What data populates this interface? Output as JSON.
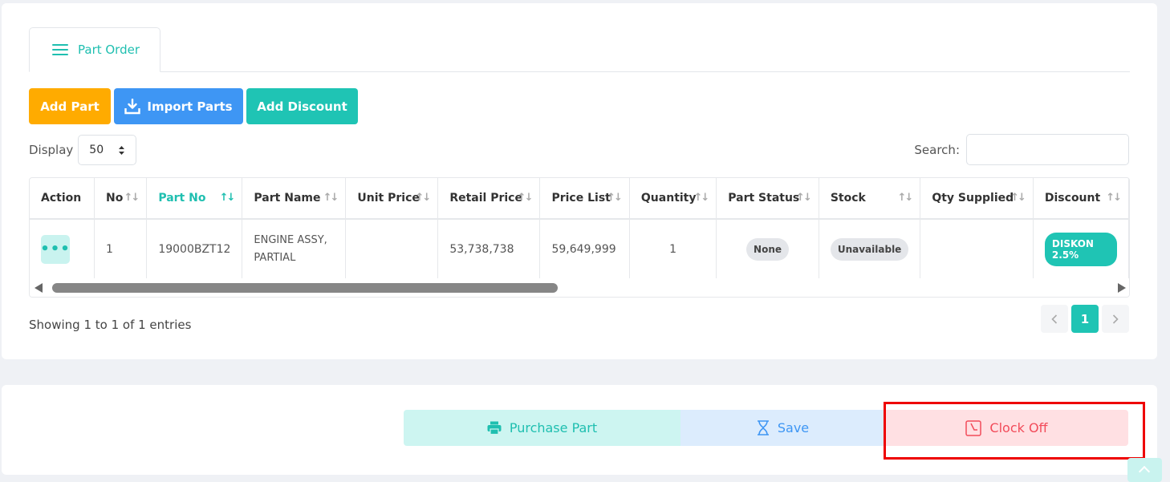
{
  "tabs": [
    {
      "label": "Part Order",
      "icon": "menu-icon"
    }
  ],
  "toolbar": {
    "add_part": "Add Part",
    "import_parts": "Import Parts",
    "add_discount": "Add Discount"
  },
  "display": {
    "label": "Display",
    "value": "50"
  },
  "search": {
    "label": "Search:",
    "value": "",
    "placeholder": ""
  },
  "table": {
    "columns": [
      "Action",
      "No",
      "Part No",
      "Part Name",
      "Unit Price",
      "Retail Price",
      "Price List",
      "Quantity",
      "Part Status",
      "Stock",
      "Qty Supplied",
      "Discount"
    ],
    "sorted_column": "Part No",
    "rows": [
      {
        "action": "•••",
        "no": "1",
        "part_no": "19000BZT12",
        "part_name": "ENGINE ASSY, PARTIAL",
        "unit_price": "",
        "retail_price": "53,738,738",
        "price_list": "59,649,999",
        "quantity": "1",
        "part_status": "None",
        "stock": "Unavailable",
        "qty_supplied": "",
        "discount": "DISKON 2.5%"
      }
    ]
  },
  "footer": {
    "info": "Showing 1 to 1 of 1 entries",
    "pages": [
      "1"
    ],
    "current_page": "1"
  },
  "actions": {
    "purchase": "Purchase Part",
    "save": "Save",
    "clock_off": "Clock Off"
  },
  "colors": {
    "accent": "#1fc4b4",
    "orange": "#ffab00",
    "blue": "#3e96f4",
    "danger": "#f24b5a",
    "highlight_box": "#ee0000"
  }
}
